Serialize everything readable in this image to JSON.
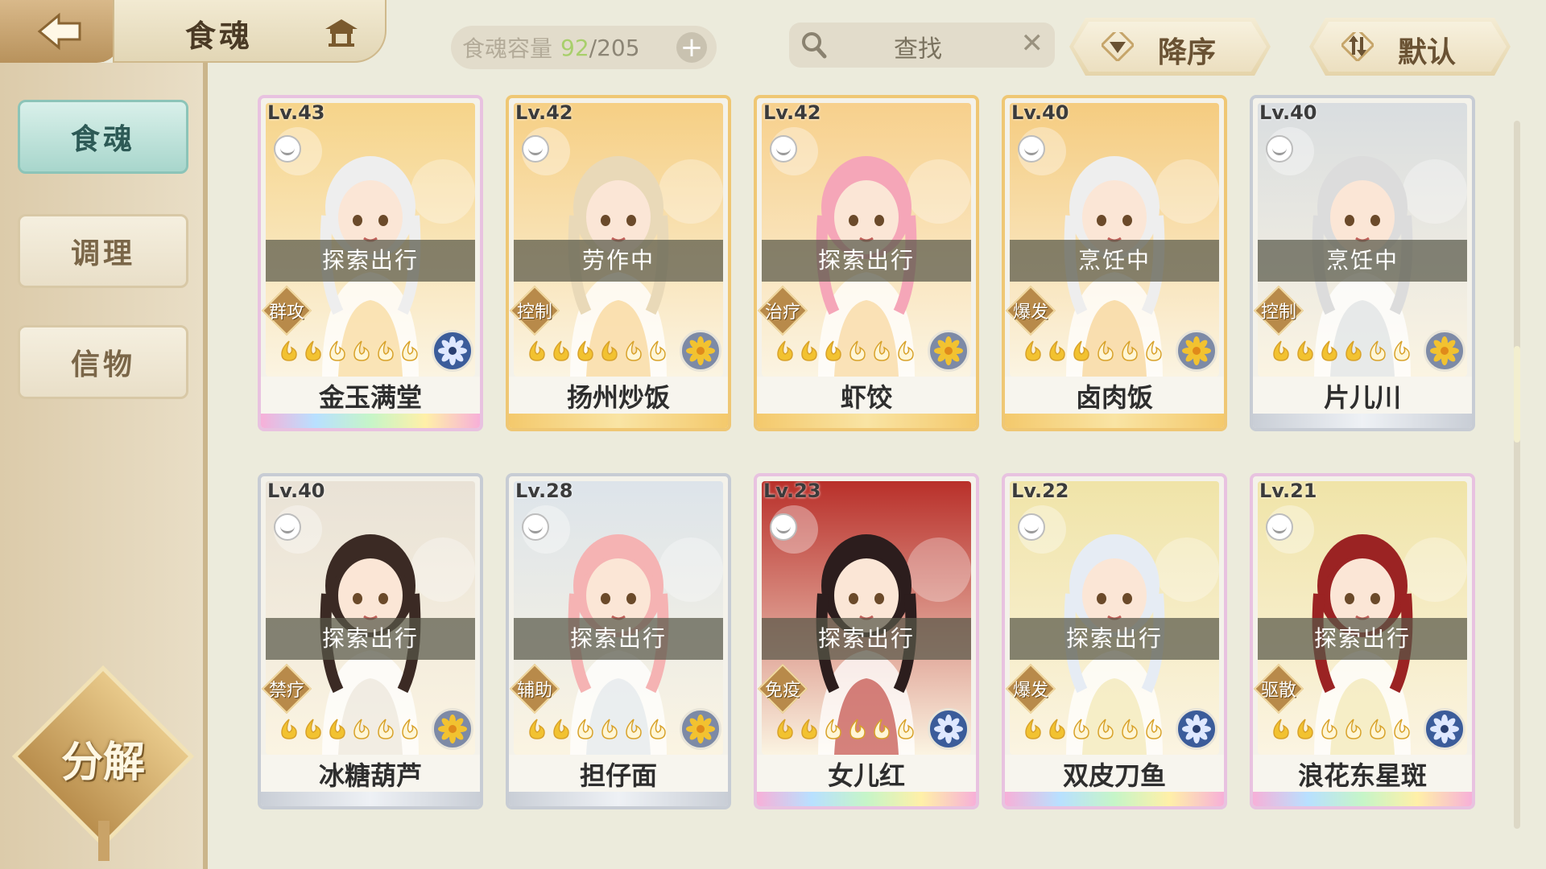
{
  "header": {
    "title": "食魂",
    "capacity_label": "食魂容量",
    "capacity_current": "92",
    "capacity_total": "/205",
    "search_placeholder": "查找",
    "sort_order": "降序",
    "sort_mode": "默认"
  },
  "sidebar": {
    "items": [
      {
        "label": "食魂",
        "active": true
      },
      {
        "label": "调理",
        "active": false
      },
      {
        "label": "信物",
        "active": false
      }
    ],
    "decompose_label": "分解"
  },
  "cards": [
    {
      "level": "Lv.43",
      "status": "探索出行",
      "role": "群攻",
      "name": "金玉满堂",
      "stars_filled": 2,
      "stars_total": 6,
      "flower": "blue",
      "hair": "#eeeeee",
      "bg": "#f6d48a",
      "rarity": "rainbow"
    },
    {
      "level": "Lv.42",
      "status": "劳作中",
      "role": "控制",
      "name": "扬州炒饭",
      "stars_filled": 4,
      "stars_total": 6,
      "flower": "gold",
      "hair": "#e9d9b8",
      "bg": "#f6cf84",
      "rarity": "gold"
    },
    {
      "level": "Lv.42",
      "status": "探索出行",
      "role": "治疗",
      "name": "虾饺",
      "stars_filled": 3,
      "stars_total": 6,
      "flower": "gold",
      "hair": "#f5a6b8",
      "bg": "#f7d08c",
      "rarity": "gold"
    },
    {
      "level": "Lv.40",
      "status": "烹饪中",
      "role": "爆发",
      "name": "卤肉饭",
      "stars_filled": 3,
      "stars_total": 6,
      "flower": "gold",
      "hair": "#eeeeee",
      "bg": "#f5cc80",
      "rarity": "gold"
    },
    {
      "level": "Lv.40",
      "status": "烹饪中",
      "role": "控制",
      "name": "片儿川",
      "stars_filled": 4,
      "stars_total": 6,
      "flower": "gold",
      "hair": "#dcdcdc",
      "bg": "#d9dde0",
      "rarity": "silver"
    },
    {
      "level": "Lv.40",
      "status": "探索出行",
      "role": "禁疗",
      "name": "冰糖葫芦",
      "stars_filled": 3,
      "stars_total": 6,
      "flower": "gold",
      "hair": "#3b2a24",
      "bg": "#e9e2d6",
      "rarity": "silver"
    },
    {
      "level": "Lv.28",
      "status": "探索出行",
      "role": "辅助",
      "name": "担仔面",
      "stars_filled": 2,
      "stars_total": 6,
      "flower": "gold",
      "hair": "#f5b3b3",
      "bg": "#dde4ea",
      "rarity": "silver"
    },
    {
      "level": "Lv.23",
      "status": "探索出行",
      "role": "免疫",
      "name": "女儿红",
      "stars_filled": 2,
      "stars_total": 6,
      "flower": "blue",
      "hair": "#2c1d1d",
      "bg": "#b9302a",
      "rarity": "rainbow"
    },
    {
      "level": "Lv.22",
      "status": "探索出行",
      "role": "爆发",
      "name": "双皮刀鱼",
      "stars_filled": 2,
      "stars_total": 6,
      "flower": "blue",
      "hair": "#e6ecf4",
      "bg": "#f0e4a8",
      "rarity": "rainbow"
    },
    {
      "level": "Lv.21",
      "status": "探索出行",
      "role": "驱散",
      "name": "浪花东星斑",
      "stars_filled": 2,
      "stars_total": 6,
      "flower": "blue",
      "hair": "#9b2323",
      "bg": "#f0e4a8",
      "rarity": "rainbow"
    }
  ],
  "colors": {
    "accent_green": "#a8cf6b",
    "active_tab": "#a8d6cc",
    "gold_star": "#f2c230",
    "flower_blue": "#3b5c9a",
    "flower_gold": "#f2c230"
  }
}
